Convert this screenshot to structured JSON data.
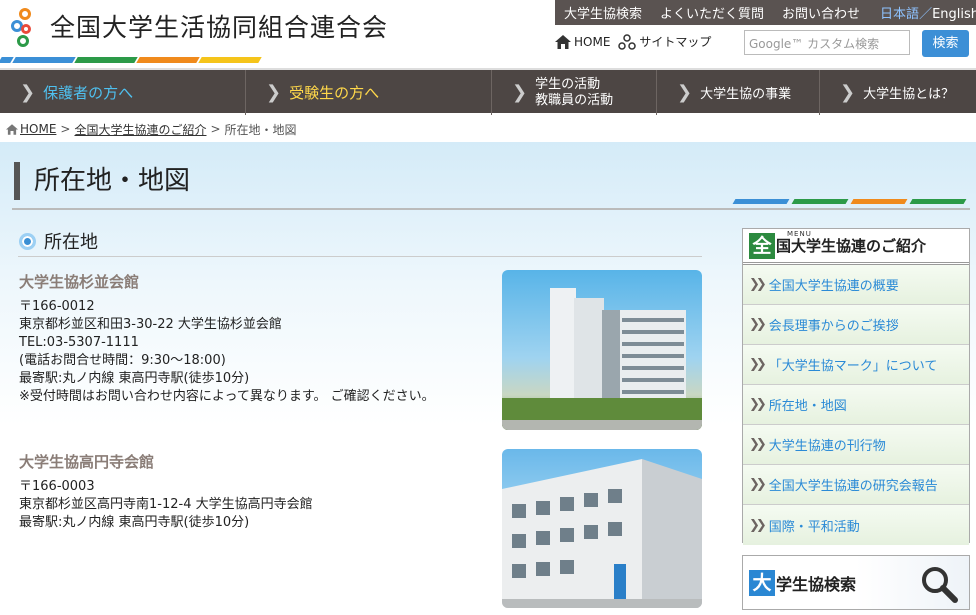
{
  "header": {
    "site_title": "全国大学生活協同組合連合会",
    "top_links": [
      "大学生協検索",
      "よくいただく質問",
      "お問い合わせ"
    ],
    "lang_jp": "日本語",
    "lang_sep": "／",
    "lang_en": "English",
    "home_label": "HOME",
    "sitemap_label": "サイトマップ",
    "search_placeholder": "Google™ カスタム検索",
    "search_button": "検索",
    "stripe_colors": [
      "#3b8fd6",
      "#2c9a48",
      "#f08a1c",
      "#e94a3a",
      "#f5c41a"
    ]
  },
  "gnav": {
    "item1": "保護者の方へ",
    "item2": "受験生の方へ",
    "item3_line1": "学生の活動",
    "item3_line2": "教職員の活動",
    "item4": "大学生協の事業",
    "item5": "大学生協とは？"
  },
  "breadcrumb": {
    "home": "HOME",
    "level1": "全国大学生協連のご紹介",
    "current": "所在地・地図",
    "sep": ">"
  },
  "page": {
    "title": "所在地・地図",
    "section_heading": "所在地"
  },
  "buildings": [
    {
      "name": "大学生協杉並会館",
      "postal": "〒166-0012",
      "address": "東京都杉並区和田3-30-22 大学生協杉並会館",
      "tel": "TEL:03-5307-1111",
      "hours": "(電話お問合せ時間：9:30〜18:00)",
      "station": "最寄駅:丸ノ内線 東高円寺駅(徒歩10分)",
      "note": "※受付時間はお問い合わせ内容によって異なります。 ご確認ください。"
    },
    {
      "name": "大学生協高円寺会館",
      "postal": "〒166-0003",
      "address": "東京都杉並区高円寺南1-12-4 大学生協高円寺会館",
      "station": "最寄駅:丸ノ内線 東高円寺駅(徒歩10分)"
    }
  ],
  "sidebar": {
    "menu_tag": "MENU",
    "head_kanji": "全",
    "head_rest": "国大学生協連のご紹介",
    "items": [
      "全国大学生協連の概要",
      "会長理事からのご挨拶",
      "「大学生協マーク」について",
      "所在地・地図",
      "大学生協連の刊行物",
      "全国大学生協連の研究会報告",
      "国際・平和活動"
    ],
    "search_kanji": "大",
    "search_rest": "学生協検索"
  },
  "colors": {
    "nav_bg": "#4d4644",
    "accent_blue": "#3c8fd6",
    "accent_yellow": "#ffd84a",
    "link_blue": "#2a8ad6"
  }
}
